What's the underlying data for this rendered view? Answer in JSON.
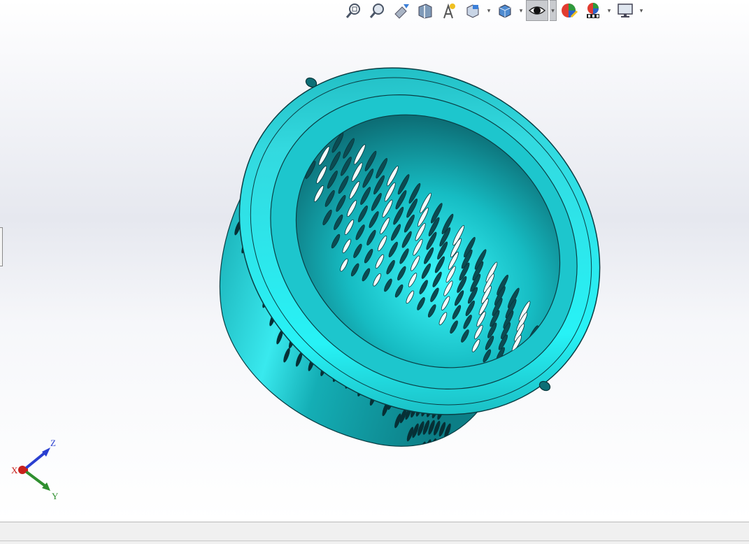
{
  "toolbar": {
    "items": [
      {
        "icon": "zoom-to-fit-icon",
        "dropdown": false,
        "active": false
      },
      {
        "icon": "zoom-to-area-icon",
        "dropdown": false,
        "active": false
      },
      {
        "icon": "previous-view-icon",
        "dropdown": false,
        "active": false
      },
      {
        "icon": "section-view-icon",
        "dropdown": false,
        "active": false
      },
      {
        "icon": "dynamic-annotation-views-icon",
        "dropdown": false,
        "active": false
      },
      {
        "icon": "view-orientation-icon",
        "dropdown": true,
        "active": false
      },
      {
        "icon": "display-style-icon",
        "dropdown": true,
        "active": false
      },
      {
        "icon": "hide-show-items-icon",
        "dropdown": true,
        "active": true
      },
      {
        "icon": "edit-appearance-icon",
        "dropdown": false,
        "active": false
      },
      {
        "icon": "apply-scene-icon",
        "dropdown": true,
        "active": false
      },
      {
        "icon": "view-settings-icon",
        "dropdown": true,
        "active": false
      }
    ]
  },
  "model": {
    "name": "perforated-basket",
    "color": "#14b8be",
    "highlight": "#3ff0f4",
    "shadow": "#0b6a72"
  },
  "triad": {
    "x_label": "X",
    "y_label": "Y",
    "z_label": "Z",
    "x_color": "#c8201c",
    "y_color": "#2f8f2f",
    "z_color": "#2a3fd0"
  }
}
